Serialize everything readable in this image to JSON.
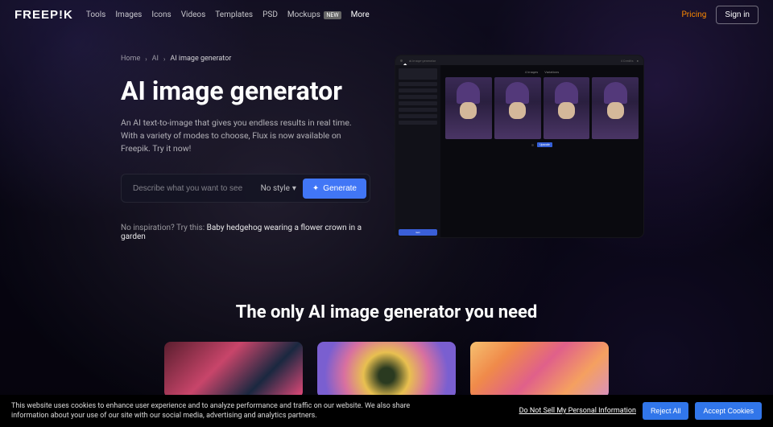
{
  "header": {
    "logo": "FREEP!K",
    "nav": [
      "Tools",
      "Images",
      "Icons",
      "Videos",
      "Templates",
      "PSD",
      "Mockups",
      "More"
    ],
    "mockups_badge": "NEW",
    "pricing": "Pricing",
    "signin": "Sign in"
  },
  "breadcrumb": {
    "home": "Home",
    "ai": "AI",
    "current": "AI image generator"
  },
  "hero": {
    "title": "AI image generator",
    "desc": "An AI text-to-image that gives you endless results in real time. With a variety of modes to choose, Flux is now available on Freepik. Try it now!",
    "placeholder": "Describe what you want to see",
    "style": "No style",
    "generate": "Generate",
    "inspiration_label": "No inspiration? Try this: ",
    "inspiration_example": "Baby hedgehog wearing a flower crown in a garden"
  },
  "preview": {
    "url": "ai.image-generator",
    "credits": "4 Credits",
    "tab1": "4 Images",
    "tab2": "Variations",
    "gen": "Gen",
    "nextbtn": "Upscale"
  },
  "section2": {
    "title": "The only AI image generator you need"
  },
  "cookie": {
    "text": "This website uses cookies to enhance user experience and to analyze performance and traffic on our website. We also share information about your use of our site with our social media, advertising and analytics partners.",
    "link": "Do Not Sell My Personal Information",
    "reject": "Reject All",
    "accept": "Accept Cookies"
  }
}
